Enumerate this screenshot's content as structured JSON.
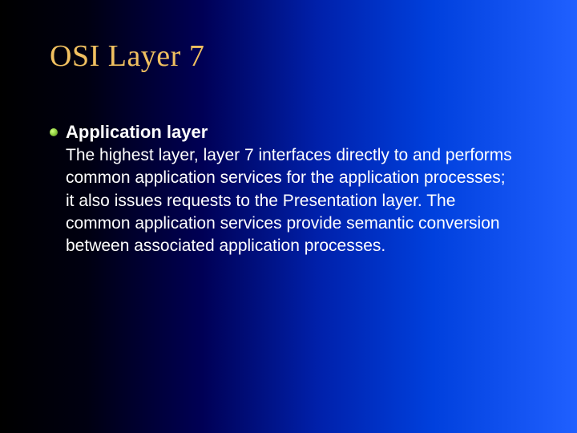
{
  "slide": {
    "title": "OSI Layer 7",
    "subheading": "Application layer",
    "body": "The highest layer,  layer 7 interfaces directly to and performs common application services for the application processes; it also issues requests to the Presentation layer. The common application services provide semantic conversion between associated application processes."
  }
}
